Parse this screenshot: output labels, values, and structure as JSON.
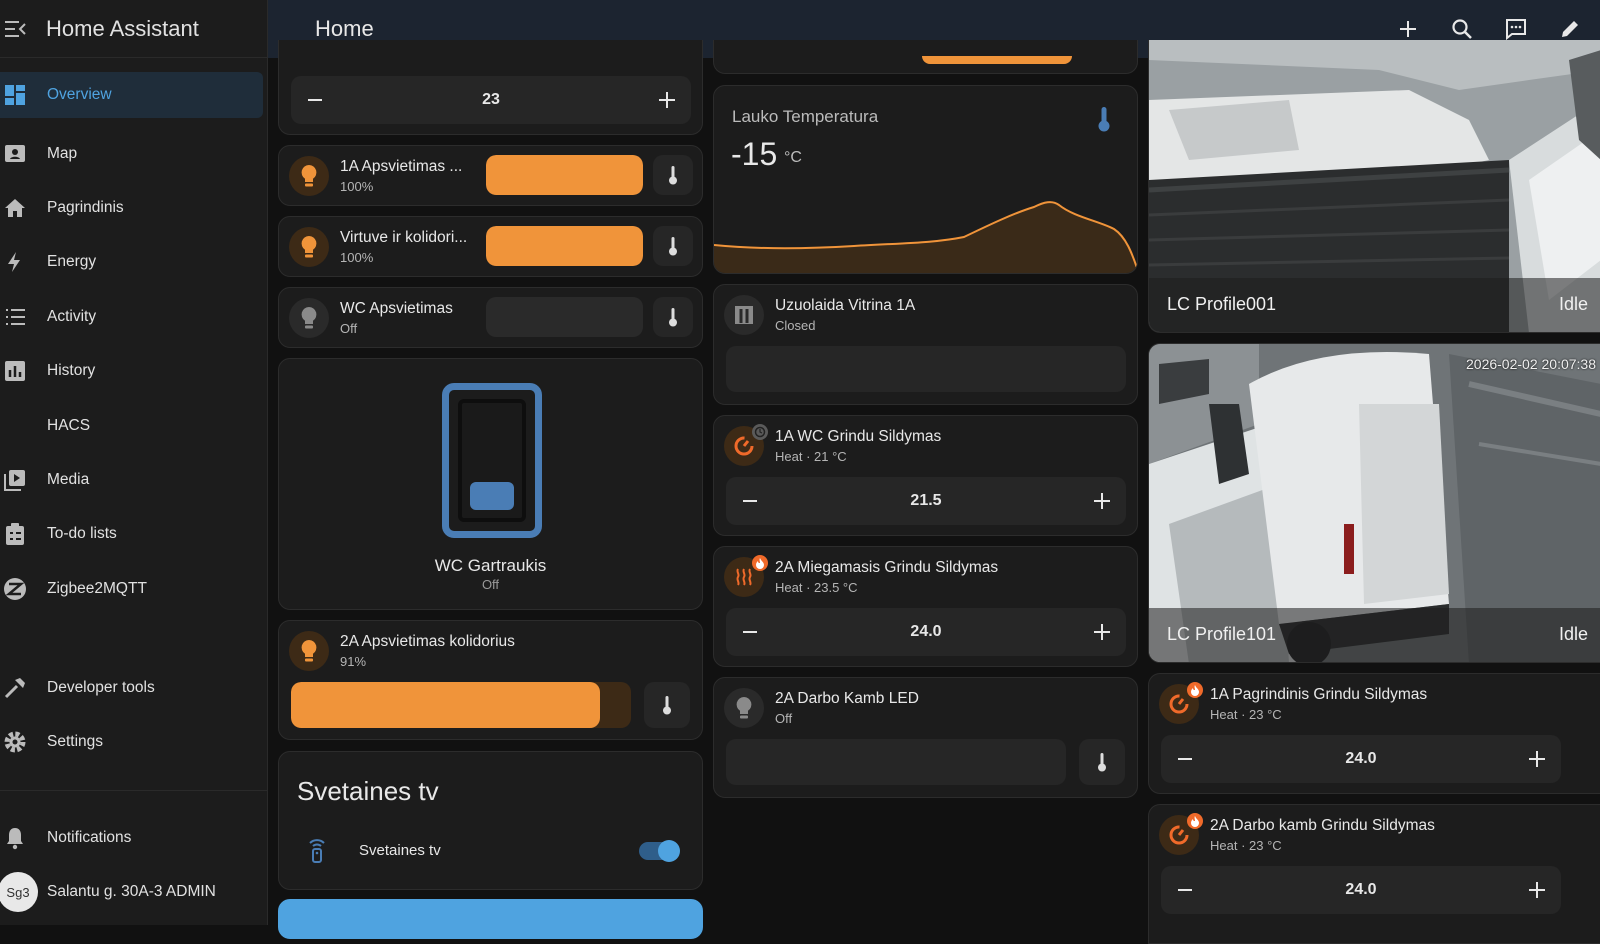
{
  "app": {
    "title": "Home Assistant"
  },
  "page": {
    "title": "Home"
  },
  "colors": {
    "accent": "#4fa3e0",
    "light_on": "#f0943a",
    "sidebar_bg": "#1c1c1c",
    "topbar_bg": "#1c2430",
    "card_bg": "#1c1c1c"
  },
  "sidebar": {
    "items": [
      {
        "label": "Overview",
        "icon": "overview-grid-icon"
      },
      {
        "label": "Map",
        "icon": "map-icon"
      },
      {
        "label": "Pagrindinis",
        "icon": "home-icon"
      },
      {
        "label": "Energy",
        "icon": "lightning-icon"
      },
      {
        "label": "Activity",
        "icon": "list-icon"
      },
      {
        "label": "History",
        "icon": "chart-icon"
      },
      {
        "label": "HACS",
        "icon": ""
      },
      {
        "label": "Media",
        "icon": "media-icon"
      },
      {
        "label": "To-do lists",
        "icon": "clipboard-icon"
      },
      {
        "label": "Zigbee2MQTT",
        "icon": "zigbee-icon"
      }
    ],
    "developer_tools": "Developer tools",
    "settings": "Settings",
    "notifications": "Notifications",
    "user": {
      "initials": "Sg3",
      "name": "Salantu g. 30A-3 ADMIN"
    }
  },
  "column1": {
    "top_stepper": {
      "value": "23"
    },
    "light1": {
      "name": "1A Apsvietimas ...",
      "state": "100%",
      "level": 100
    },
    "light2": {
      "name": "Virtuve ir kolidori...",
      "state": "100%",
      "level": 100
    },
    "light3": {
      "name": "WC Apsvietimas",
      "state": "Off",
      "level": 0
    },
    "cover": {
      "name": "WC Gartraukis",
      "state": "Off"
    },
    "light4": {
      "name": "2A Apsvietimas kolidorius",
      "state": "91%",
      "level": 91
    },
    "media": {
      "title": "Svetaines tv",
      "entity": "Svetaines tv"
    }
  },
  "column2": {
    "sensor": {
      "name": "Lauko Temperatura",
      "value": "-15",
      "unit": "°C"
    },
    "curtain": {
      "name": "Uzuolaida Vitrina 1A",
      "state": "Closed"
    },
    "heat1": {
      "name": "1A WC Grindu Sildymas",
      "state": "Heat · 21 °C",
      "value": "21.5"
    },
    "heat2": {
      "name": "2A Miegamasis Grindu Sildymas",
      "state": "Heat · 23.5 °C",
      "value": "24.0"
    },
    "led": {
      "name": "2A Darbo Kamb LED",
      "state": "Off"
    }
  },
  "column3": {
    "cam1": {
      "name": "LC Profile001",
      "state": "Idle"
    },
    "cam2": {
      "name": "LC Profile101",
      "state": "Idle",
      "timestamp": "2026-02-02 20:07:38"
    },
    "heat3": {
      "name": "1A Pagrindinis Grindu Sildymas",
      "state": "Heat · 23 °C",
      "value": "24.0"
    },
    "heat4": {
      "name": "2A Darbo kamb Grindu Sildymas",
      "state": "Heat · 23 °C",
      "value": "24.0"
    }
  }
}
